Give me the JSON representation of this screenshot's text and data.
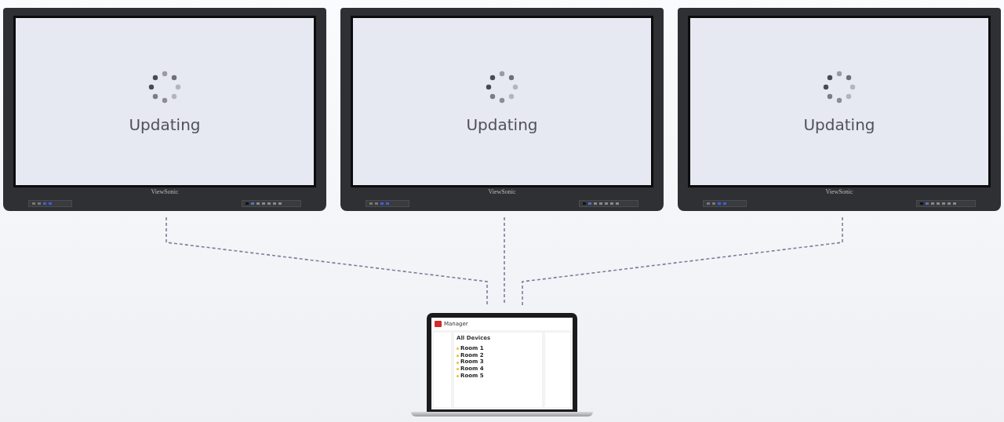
{
  "displays": [
    {
      "status": "Updating",
      "brand": "ViewSonic"
    },
    {
      "status": "Updating",
      "brand": "ViewSonic"
    },
    {
      "status": "Updating",
      "brand": "ViewSonic"
    }
  ],
  "laptop": {
    "app_title": "Manager",
    "section_title": "All Devices",
    "rooms": [
      {
        "name": "Room 1"
      },
      {
        "name": "Room 2"
      },
      {
        "name": "Room 3"
      },
      {
        "name": "Room 4"
      },
      {
        "name": "Room 5"
      }
    ]
  }
}
